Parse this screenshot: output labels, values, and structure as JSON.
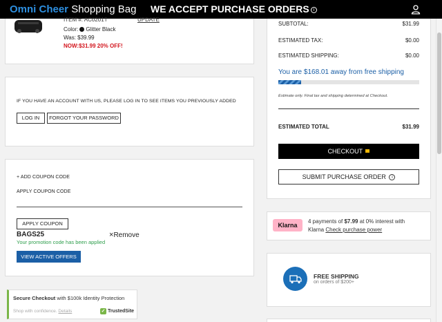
{
  "header": {
    "brand_first": "Omni Cheer",
    "brand_second": "Shopping Bag",
    "promo": "WE ACCEPT PURCHASE ORDERS"
  },
  "cart_item": {
    "item_number": "ITEM #: AC0201T",
    "update_label": "UPDATE",
    "color_label": "Color:",
    "color_value": "Glitter Black",
    "was": "Was: $39.99",
    "now": "NOW:$31.99 20% OFF!"
  },
  "account": {
    "message": "IF YOU HAVE AN ACCOUNT WITH US, PLEASE LOG IN TO SEE ITEMS YOU PREVIOUSLY ADDED",
    "login_label": "LOG IN",
    "forgot_label": "FORGOT YOUR PASSWORD"
  },
  "coupon": {
    "add_label": "+ ADD COUPON CODE",
    "apply_heading": "APPLY COUPON CODE",
    "input_value": "",
    "apply_button": "APPLY COUPON",
    "code": "BAGS25",
    "remove_label": "Remove",
    "applied_message": "Your promotion code has been applied",
    "offers_button": "VIEW ACTIVE OFFERS"
  },
  "secure": {
    "title_bold": "Secure Checkout",
    "title_rest": "with $100k Identity Protection",
    "sub": "Shop with confidence.",
    "details_link": "Details",
    "badge": "TrustedSite"
  },
  "summary": {
    "subtotal_label": "SUBTOTAL:",
    "subtotal_value": "$31.99",
    "tax_label": "ESTIMATED TAX:",
    "tax_value": "$0.00",
    "shipping_label": "ESTIMATED SHIPPING:",
    "shipping_value": "$0.00",
    "free_ship_message": "You are $168.01 away from free shipping",
    "free_ship_progress": 0.16,
    "estimate_note": "Estimate only. Final tax and shipping determined at Checkout.",
    "total_label": "ESTIMATED TOTAL",
    "total_value": "$31.99",
    "checkout_button": "CHECKOUT",
    "po_button": "SUBMIT PURCHASE ORDER"
  },
  "klarna": {
    "logo": "Klarna",
    "text_before": "4 payments of",
    "amount": "$7.99",
    "text_after": "at 0% interest with",
    "text_klarna": "Klarna",
    "link": "Check purchase power"
  },
  "free_shipping_banner": {
    "title": "FREE SHIPPING",
    "sub": "on orders of $200+"
  },
  "colors": {
    "brand_blue": "#2d8fe0",
    "sale_red": "#d2141c",
    "button_blue": "#1b5fa6",
    "success_green": "#2e9e4c",
    "klarna_pink": "#ffb3c7"
  }
}
